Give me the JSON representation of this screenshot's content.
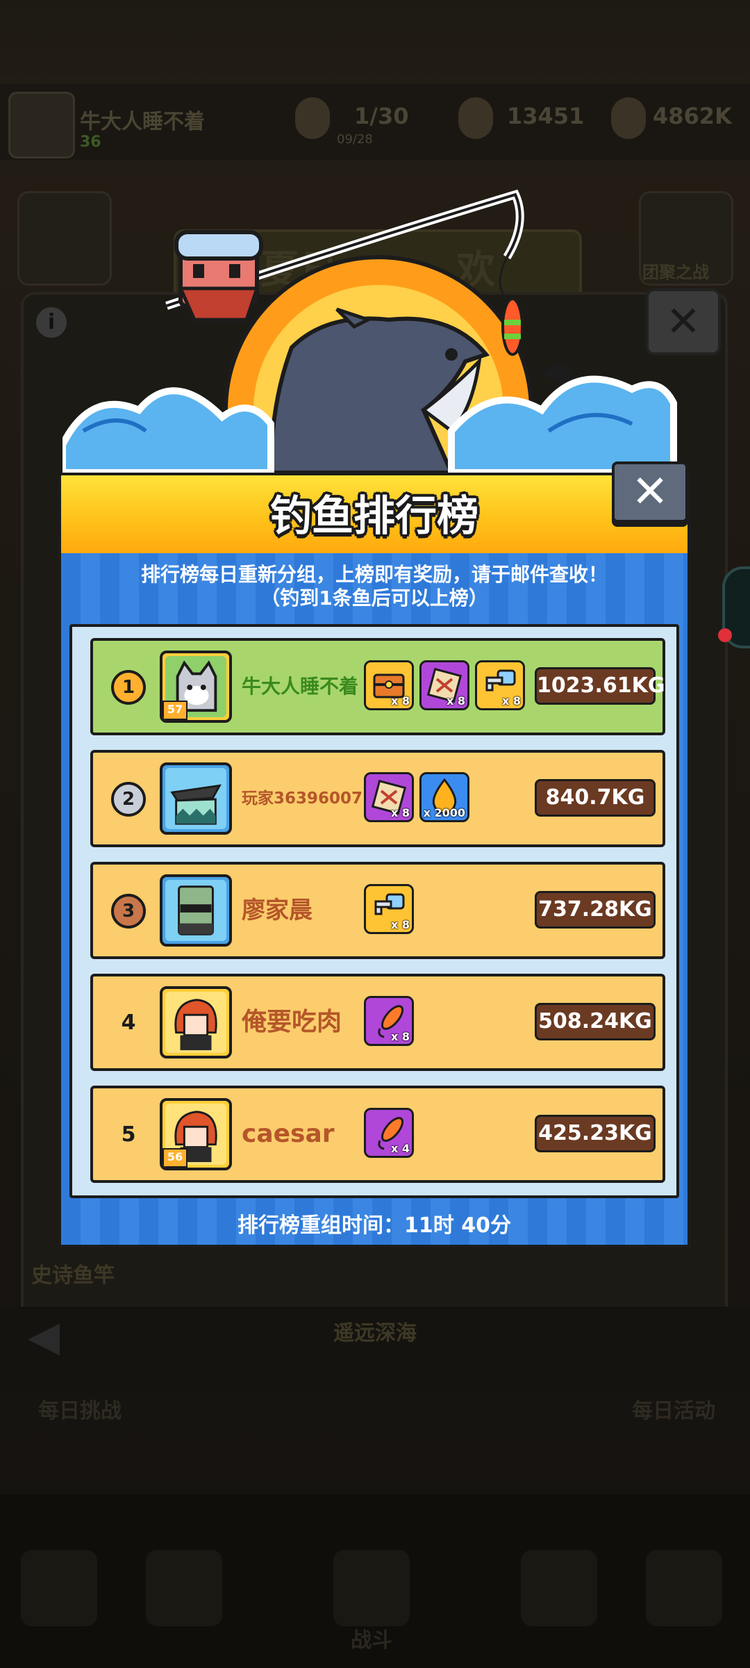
{
  "player_bar": {
    "name": "牛大人睡不着",
    "level": "36",
    "stat1": "1/30",
    "stat1_sub": "09/28",
    "stat2": "13451",
    "stat3": "4862K"
  },
  "background": {
    "event_title": "夏日",
    "event_title_end": "欢",
    "side_label": "团聚之战",
    "rod_label": "史诗鱼竿",
    "location": "遥远深海",
    "daily_challenge": "每日挑战",
    "daily_event": "每日活动",
    "nav_center": "战斗"
  },
  "modal": {
    "title": "钓鱼排行榜",
    "notice_line1": "排行榜每日重新分组，上榜即有奖励，请于邮件查收！",
    "notice_line2": "（钓到1条鱼后可以上榜）",
    "footer": "排行榜重组时间：11时 40分"
  },
  "leaderboard": [
    {
      "rank": "1",
      "name": "牛大人睡不着",
      "level": "57",
      "weight": "1023.61KG",
      "rewards": [
        {
          "icon": "chest-icon",
          "count": "x 8"
        },
        {
          "icon": "map-icon",
          "count": "x 8"
        },
        {
          "icon": "key-icon",
          "count": "x 8"
        }
      ]
    },
    {
      "rank": "2",
      "name": "玩家36396007",
      "level": "",
      "weight": "840.7KG",
      "rewards": [
        {
          "icon": "map-icon",
          "count": "x 8"
        },
        {
          "icon": "oil-drop-icon",
          "count": "x 2000"
        }
      ]
    },
    {
      "rank": "3",
      "name": "廖家晨",
      "level": "",
      "weight": "737.28KG",
      "rewards": [
        {
          "icon": "key-icon",
          "count": "x 8"
        }
      ]
    },
    {
      "rank": "4",
      "name": "俺要吃肉",
      "level": "",
      "weight": "508.24KG",
      "rewards": [
        {
          "icon": "lure-icon",
          "count": "x 8"
        }
      ]
    },
    {
      "rank": "5",
      "name": "caesar",
      "level": "56",
      "weight": "425.23KG",
      "rewards": [
        {
          "icon": "lure-icon",
          "count": "x 4"
        }
      ]
    }
  ],
  "colors": {
    "first_row": "#a8d66c",
    "other_rows": "#fbcd6c",
    "first_name": "#3a8a1e",
    "other_name": "#b5562a",
    "gold_medal": "#ffb02e",
    "silver_medal": "#c9cfd8",
    "bronze_medal": "#c9774a"
  }
}
